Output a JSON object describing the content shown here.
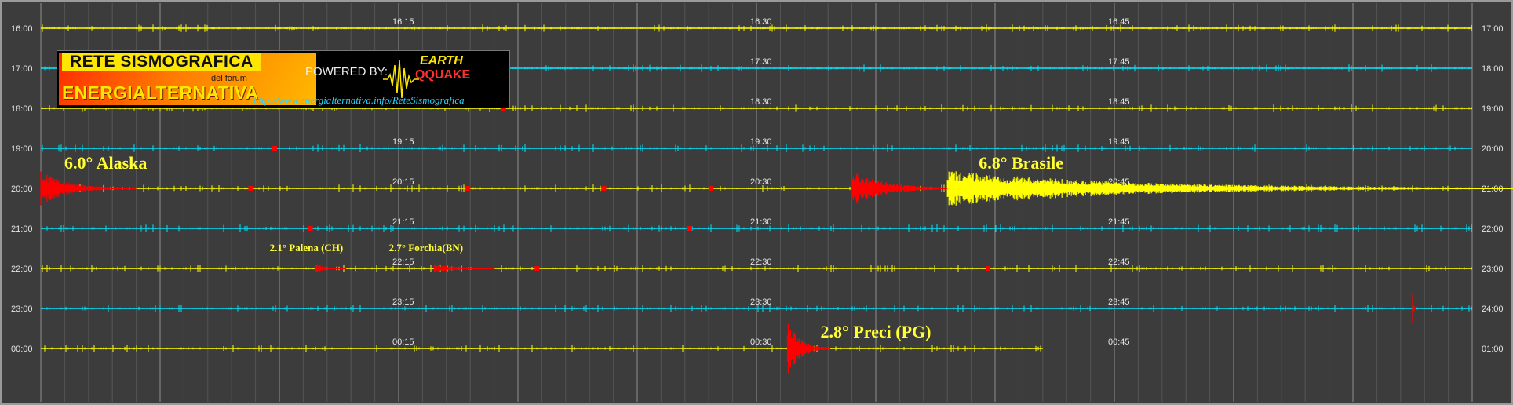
{
  "logo": {
    "top_label": "RETE SISMOGRAFICA",
    "forum": "del forum",
    "brand": "ENERGIALTERNATIVA",
    "powered": "POWERED BY:",
    "eq_line1": "EARTH",
    "eq_line2": "QQUAKE",
    "url": "http://www.energialternativa.info/ReteSismografica"
  },
  "colors": {
    "background": "#3c3c3c",
    "yellow": "#ffff00",
    "cyan": "#00e5ff",
    "event": "#ff0000",
    "annotation": "#ffff33",
    "grid": "#888888"
  },
  "chart_data": {
    "type": "line",
    "grid": true,
    "rows": [
      {
        "left": "16:00",
        "right": "17:00",
        "color": "yellow",
        "mid": [
          "16:15",
          "16:30",
          "16:45"
        ]
      },
      {
        "left": "17:00",
        "right": "18:00",
        "color": "cyan",
        "mid": [
          "",
          "17:30",
          "17:45"
        ]
      },
      {
        "left": "18:00",
        "right": "19:00",
        "color": "yellow",
        "mid": [
          "",
          "18:30",
          "18:45"
        ]
      },
      {
        "left": "19:00",
        "right": "20:00",
        "color": "cyan",
        "mid": [
          "19:15",
          "19:30",
          "19:45"
        ]
      },
      {
        "left": "20:00",
        "right": "21:00",
        "color": "yellow",
        "mid": [
          "20:15",
          "20:30",
          "20:45"
        ]
      },
      {
        "left": "21:00",
        "right": "22:00",
        "color": "cyan",
        "mid": [
          "21:15",
          "21:30",
          "21:45"
        ]
      },
      {
        "left": "22:00",
        "right": "23:00",
        "color": "yellow",
        "mid": [
          "22:15",
          "22:30",
          "22:45"
        ]
      },
      {
        "left": "23:00",
        "right": "24:00",
        "color": "cyan",
        "mid": [
          "23:15",
          "23:30",
          "23:45"
        ]
      },
      {
        "left": "00:00",
        "right": "01:00",
        "color": "yellow",
        "mid": [
          "00:15",
          "00:30",
          "00:45"
        ]
      }
    ],
    "events": [
      {
        "label": "6.0° Alaska",
        "row": 4,
        "minute": 0,
        "duration_min": 4,
        "amplitude": 0.85,
        "color": "red"
      },
      {
        "label": "6.8° Brasile",
        "row": 4,
        "minute": 38,
        "duration_min": 26,
        "amplitude": 0.9,
        "color": "yellow",
        "precursor_minute": 34
      },
      {
        "label": "2.1° Palena (CH)",
        "row": 6,
        "minute": 11.5,
        "duration_min": 1.3,
        "amplitude": 0.25,
        "color": "red"
      },
      {
        "label": "2.7° Forchia(BN)",
        "row": 6,
        "minute": 16.5,
        "duration_min": 2.5,
        "amplitude": 0.25,
        "color": "red"
      },
      {
        "label": "2.8° Preci (PG)",
        "row": 8,
        "minute": 31.3,
        "duration_min": 1.8,
        "amplitude": 1.4,
        "color": "red",
        "spread": 1.6
      },
      {
        "label": "",
        "row": 7,
        "minute": 57.5,
        "duration_min": 0.15,
        "amplitude": 0.7,
        "color": "red"
      }
    ],
    "trace_end_minute": {
      "8": 42
    }
  }
}
